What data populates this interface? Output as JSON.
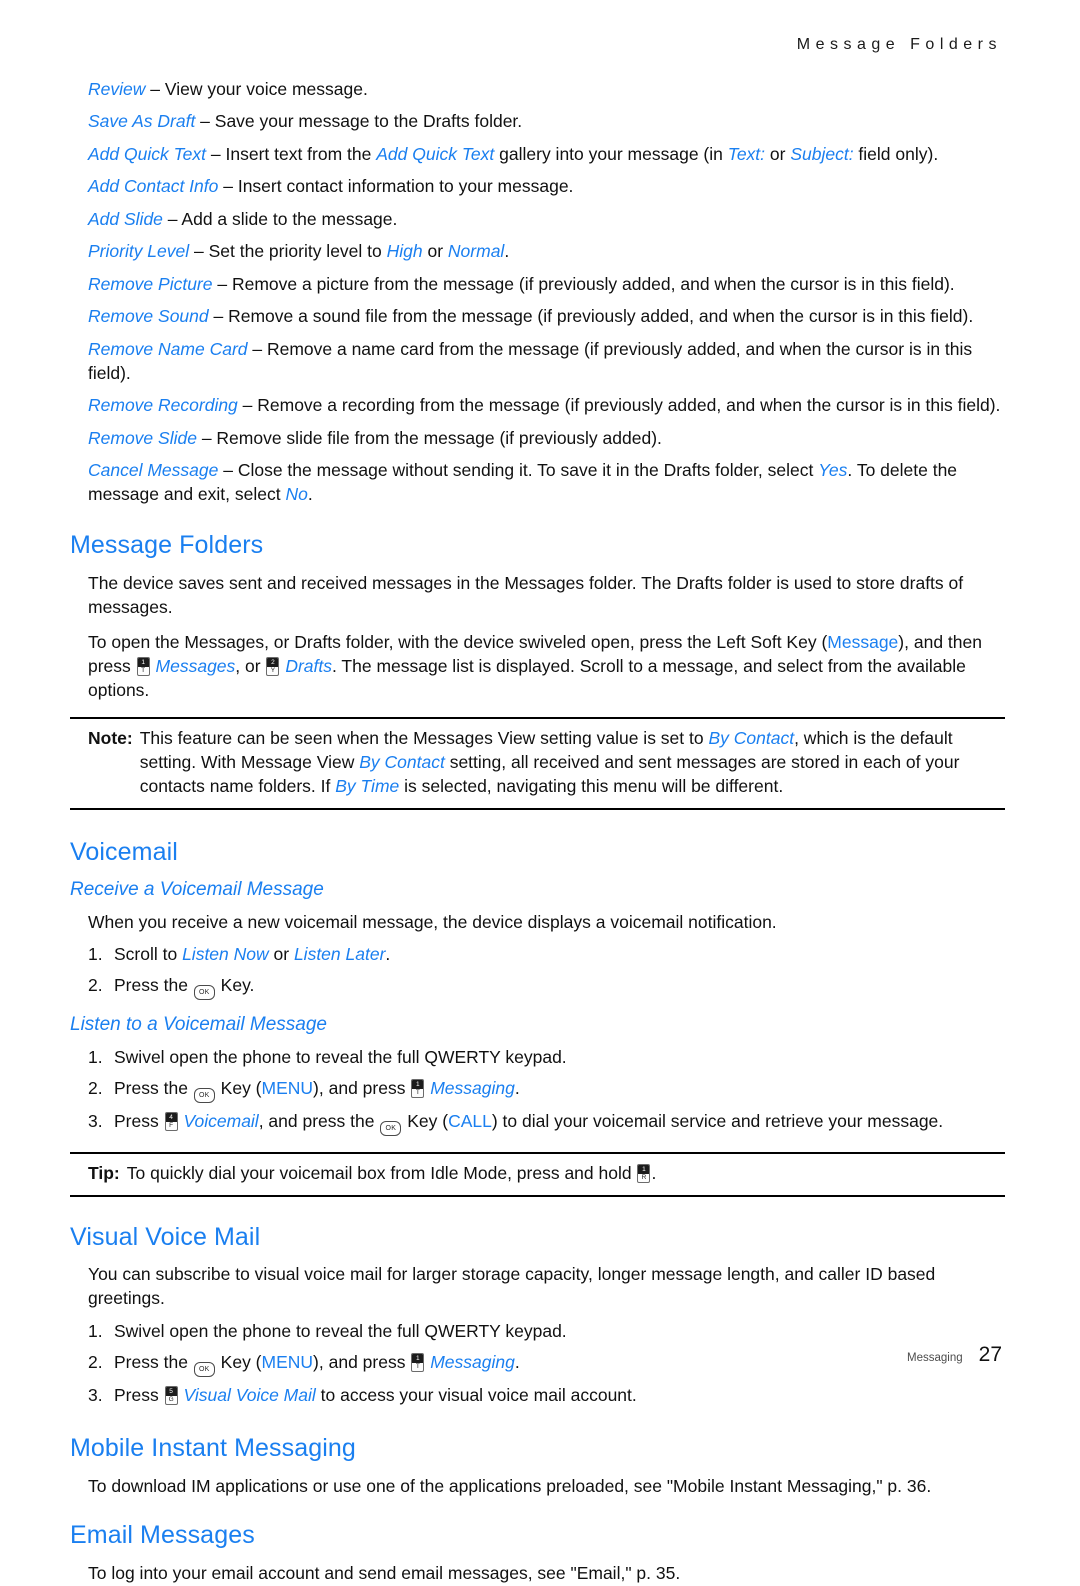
{
  "header": {
    "running_title": "Message Folders"
  },
  "options": [
    {
      "term": "Review",
      "rest": " – View your voice message."
    },
    {
      "term": "Save As Draft",
      "rest": " – Save your message to the Drafts folder."
    },
    {
      "term": "Add Quick Text",
      "rest": " – Insert text from the Add Quick Text gallery into your message (in Text: or Subject: field only)."
    },
    {
      "term": "Add Contact Info",
      "rest": " – Insert contact information to your message."
    },
    {
      "term": "Add Slide",
      "rest": " – Add a slide to the message."
    },
    {
      "term": "Priority Level",
      "rest": " – Set the priority level to High or Normal."
    },
    {
      "term": "Remove Picture",
      "rest": " – Remove a picture from the message (if previously added, and when the cursor is in this field)."
    },
    {
      "term": "Remove Sound",
      "rest": " – Remove a sound file from the message (if previously added, and when the cursor is in this field)."
    },
    {
      "term": "Remove Name Card",
      "rest": " – Remove a name card from the message (if previously added, and when the cursor is in this field)."
    },
    {
      "term": "Remove Recording",
      "rest": " – Remove a recording from the message (if previously added, and when the cursor is in this field)."
    },
    {
      "term": "Remove Slide",
      "rest": " – Remove slide file from the message (if previously added)."
    },
    {
      "term": "Cancel Message",
      "rest": " – Close the message without sending it. To save it in the Drafts folder, select Yes. To delete the message and exit, select No."
    }
  ],
  "option_inline_terms": {
    "add_quick_text_gallery": "Add Quick Text",
    "text_field": "Text:",
    "subject_field": "Subject:",
    "high": "High",
    "normal": "Normal",
    "yes": "Yes",
    "no": "No"
  },
  "message_folders": {
    "heading": "Message Folders",
    "para1": "The device saves sent and received messages in the Messages folder. The Drafts folder is used to store drafts of messages.",
    "para2_a": "To open the Messages, or Drafts folder, with the device swiveled open, press the Left Soft Key (",
    "para2_message_link": "Message",
    "para2_b": "), and then press ",
    "para2_messages_link": "Messages",
    "para2_c": ", or ",
    "para2_drafts_link": "Drafts",
    "para2_d": ". The message list is displayed. Scroll to a message, and select from the available options."
  },
  "note": {
    "label": "Note:",
    "line1_a": "This feature can be seen when the Messages View setting value is set to ",
    "line1_link": "By Contact",
    "line1_b": ", which is the default setting. With Message View ",
    "line2_link": "By Contact",
    "line2_b": " setting, all received and sent messages are stored in each of your contacts name folders. If ",
    "line3_link": "By Time",
    "line3_b": " is selected, navigating this menu will be different."
  },
  "voicemail": {
    "heading": "Voicemail",
    "receive": {
      "heading": "Receive a Voicemail Message",
      "intro": "When you receive a new voicemail message, the device displays a voicemail notification.",
      "steps": [
        {
          "num": "1.",
          "a": "Scroll to ",
          "link1": "Listen Now",
          "b": " or ",
          "link2": "Listen Later",
          "c": "."
        },
        {
          "num": "2.",
          "a": "Press the ",
          "b": " Key."
        }
      ]
    },
    "listen": {
      "heading": "Listen to a Voicemail Message",
      "step1": {
        "num": "1.",
        "text": "Swivel open the phone to reveal the full QWERTY keypad."
      },
      "step2": {
        "num": "2.",
        "a": "Press the ",
        "b": " Key (",
        "menu": "MENU",
        "c": "), and press ",
        "messaging": "Messaging",
        "d": "."
      },
      "step3": {
        "num": "3.",
        "a": "Press ",
        "voicemail": "Voicemail",
        "b": ", and press the ",
        "c": " Key (",
        "call": "CALL",
        "d": ") to dial your voicemail service and retrieve your message."
      }
    }
  },
  "tip": {
    "label": "Tip:",
    "text_a": "To quickly dial your voicemail box from Idle Mode, press and hold ",
    "text_b": "."
  },
  "visual_voice_mail": {
    "heading": "Visual Voice Mail",
    "intro": "You can subscribe to visual voice mail for larger storage capacity, longer message length, and caller ID based greetings.",
    "step1": {
      "num": "1.",
      "text": "Swivel open the phone to reveal the full QWERTY keypad."
    },
    "step2": {
      "num": "2.",
      "a": "Press the ",
      "b": " Key (",
      "menu": "MENU",
      "c": "), and press ",
      "messaging": "Messaging",
      "d": "."
    },
    "step3": {
      "num": "3.",
      "a": "Press ",
      "link": "Visual Voice Mail",
      "b": " to access your visual voice mail account."
    }
  },
  "mobile_instant_messaging": {
    "heading": "Mobile Instant Messaging",
    "text": "To download IM applications or use one of the applications preloaded, see \"Mobile Instant Messaging,\" p. 36."
  },
  "email_messages": {
    "heading": "Email Messages",
    "text": "To log into your email account and send email messages, see \"Email,\" p. 35."
  },
  "key_icons": {
    "ok_key": "OK",
    "msg_key_cap": "1",
    "msg_key_sub": "T",
    "drafts_key_cap": "2",
    "drafts_key_sub": "Y",
    "messaging_key_cap": "1",
    "messaging_key_sub": "T",
    "voicemail_key_cap": "4",
    "voicemail_key_sub": "F",
    "vvm_key_cap": "5",
    "vvm_key_sub": "G",
    "tip_key_cap": "1",
    "tip_key_sub": "R"
  },
  "footer": {
    "section": "Messaging",
    "page": "27"
  },
  "colors": {
    "accent_blue": "#1a7ff0",
    "body_text": "#111111",
    "footer_gray": "#4d4d4d"
  }
}
